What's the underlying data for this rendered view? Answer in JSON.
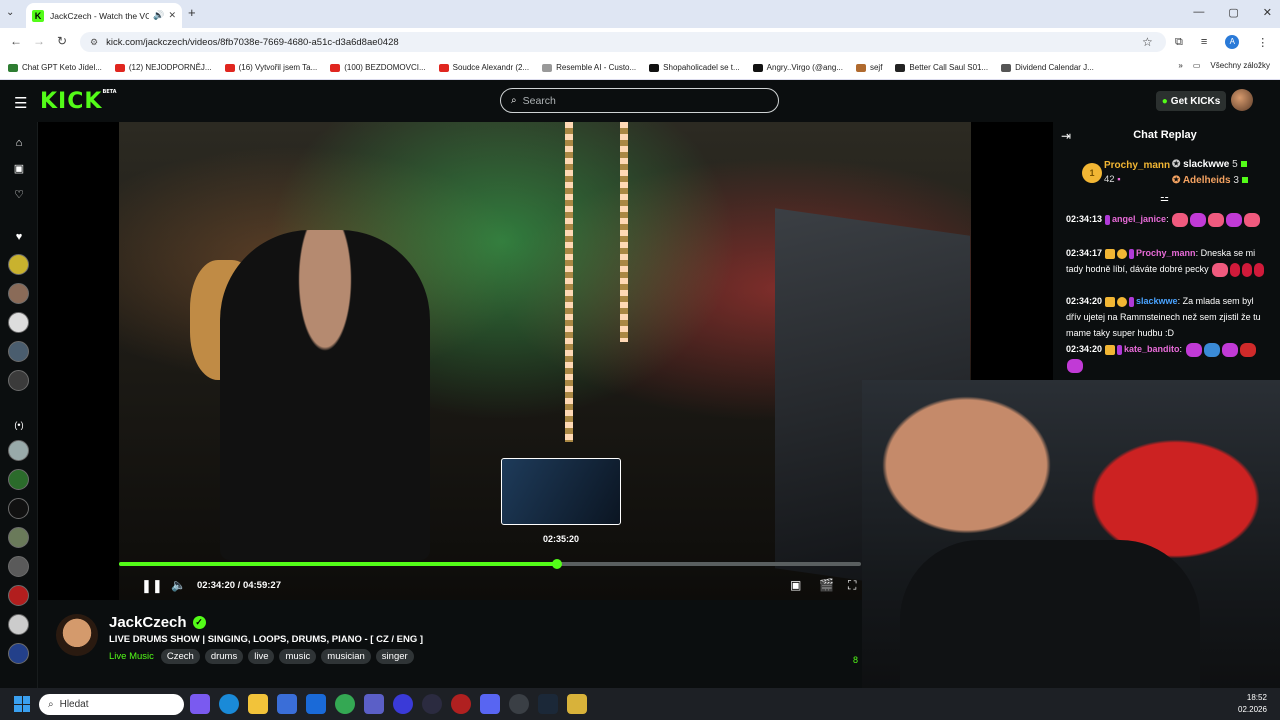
{
  "browser": {
    "tab_title": "JackCzech - Watch the VOD",
    "url": "kick.com/jackczech/videos/8fb7038e-7669-4680-a51c-d3a6d8ae0428",
    "bookmarks": [
      {
        "label": "Chat GPT Keto Jídel...",
        "color": "#2e7d32"
      },
      {
        "label": "(12) NEJODPORNĚJ...",
        "color": "#e0261f"
      },
      {
        "label": "(16) Vytvořil jsem Ta...",
        "color": "#e0261f"
      },
      {
        "label": "(100) BEZDOMOVCI...",
        "color": "#e0261f"
      },
      {
        "label": "Soudce Alexandr (2...",
        "color": "#e0261f"
      },
      {
        "label": "Resemble AI - Custo...",
        "color": "#999999"
      },
      {
        "label": "Shopaholicadel se t...",
        "color": "#111111"
      },
      {
        "label": "Angry..Virgo (@ang...",
        "color": "#111111"
      },
      {
        "label": "sejf",
        "color": "#b06a2e"
      },
      {
        "label": "Better Call Saul S01...",
        "color": "#222222"
      },
      {
        "label": "Dividend Calendar J...",
        "color": "#555555"
      }
    ],
    "all_bookmarks": "Všechny záložky",
    "profile_letter": "A"
  },
  "kick": {
    "logo": "KICK",
    "logo_badge": "BETA",
    "search_placeholder": "Search",
    "get_kicks": "Get KICKs"
  },
  "player": {
    "preview_time": "02:35:20",
    "time": "02:34:20 / 04:59:27",
    "progress": 0.59
  },
  "channel": {
    "name": "JackCzech",
    "title": "LIVE DRUMS SHOW | SINGING, LOOPS, DRUMS, PIANO - [ CZ / ENG ]",
    "category": "Live Music",
    "tags": [
      "Czech",
      "drums",
      "live",
      "music",
      "musician",
      "singer"
    ],
    "side_number": "8"
  },
  "chat": {
    "title": "Chat Replay",
    "leaderboard": {
      "first": {
        "rank": "1",
        "name": "Prochy_mann",
        "count": "42"
      },
      "second": {
        "name": "slackwwe",
        "count": "5"
      },
      "third": {
        "name": "Adelheids",
        "count": "3"
      }
    },
    "messages": [
      {
        "time": "02:34:13",
        "user": "angel_janice",
        "user_color": "#e86bd8",
        "text": ""
      },
      {
        "time": "02:34:17",
        "user": "Prochy_mann",
        "user_color": "#e86bd8",
        "text": "Dneska se mi tady hodně líbí, dáváte dobré pecky"
      },
      {
        "time": "02:34:20",
        "user": "slackwwe",
        "user_color": "#4aa3ff",
        "text": "Za mlada sem byl dřív ujetej na Rammsteinech než sem zjistil že tu mame taky super hudbu :D"
      },
      {
        "time": "02:34:20",
        "user": "kate_bandito",
        "user_color": "#e86bd8",
        "text": ""
      }
    ]
  },
  "taskbar": {
    "search_placeholder": "Hledat",
    "clock_time": "18:52",
    "clock_date": "02.2026"
  }
}
